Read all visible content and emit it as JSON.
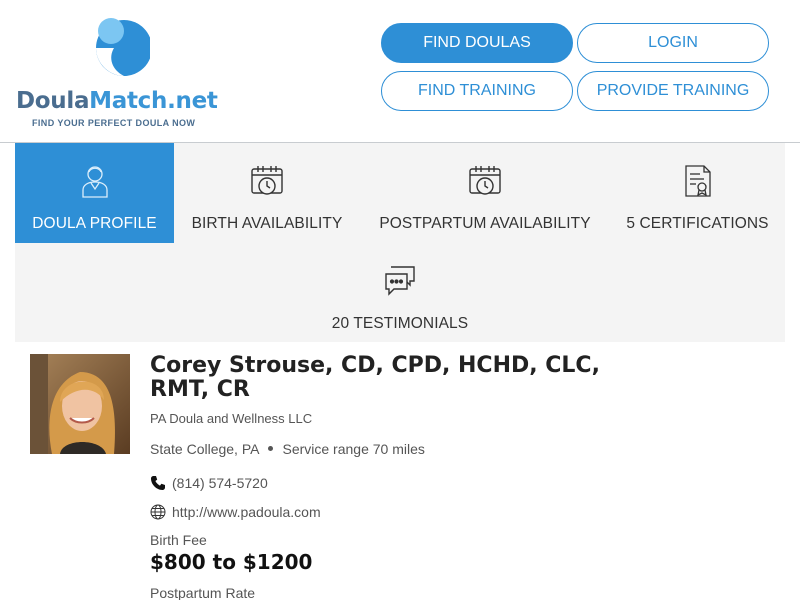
{
  "brand": {
    "name_part1": "Doula",
    "name_part2": "Match.net",
    "tagline": "FIND YOUR PERFECT DOULA NOW",
    "colors": {
      "primary": "#2e8fd6",
      "dark": "#4a6d8f",
      "accent": "#3a95d6"
    }
  },
  "nav": {
    "find_doulas": "FIND DOULAS",
    "login": "LOGIN",
    "find_training": "FIND TRAINING",
    "provide_training": "PROVIDE TRAINING"
  },
  "tabs": [
    {
      "label": "DOULA PROFILE",
      "icon": "person-icon",
      "active": true
    },
    {
      "label": "BIRTH AVAILABILITY",
      "icon": "calendar-clock-icon",
      "active": false
    },
    {
      "label": "POSTPARTUM AVAILABILITY",
      "icon": "calendar-clock-icon",
      "active": false
    },
    {
      "label": "5 CERTIFICATIONS",
      "icon": "certificate-icon",
      "active": false
    },
    {
      "label": "20 TESTIMONIALS",
      "icon": "chat-bubbles-icon",
      "active": false
    }
  ],
  "profile": {
    "name": "Corey Strouse, CD, CPD, HCHD, CLC, RMT, CR",
    "organization": "PA Doula and Wellness LLC",
    "location": "State College, PA",
    "service_range": "Service range 70 miles",
    "phone": "(814) 574-5720",
    "website": "http://www.padoula.com",
    "birth_fee_label": "Birth Fee",
    "birth_fee": "$800 to $1200",
    "postpartum_rate_label": "Postpartum Rate"
  }
}
